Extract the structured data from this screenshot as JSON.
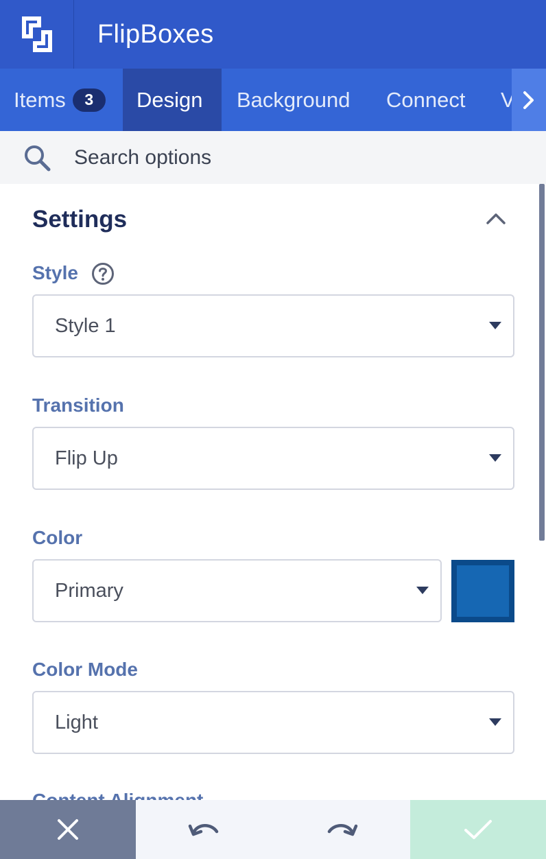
{
  "header": {
    "title": "FlipBoxes",
    "logo_icon": "flipboxes-logo-icon"
  },
  "tabs": [
    {
      "label": "Items",
      "badge": "3"
    },
    {
      "label": "Design",
      "active": true
    },
    {
      "label": "Background"
    },
    {
      "label": "Connect"
    },
    {
      "label": "V"
    }
  ],
  "search": {
    "placeholder": "Search options",
    "icon": "search-icon"
  },
  "settings": {
    "title": "Settings",
    "fields": [
      {
        "label": "Style",
        "value": "Style 1",
        "has_help": true
      },
      {
        "label": "Transition",
        "value": "Flip Up"
      },
      {
        "label": "Color",
        "value": "Primary",
        "swatch_color": "#1667b3"
      },
      {
        "label": "Color Mode",
        "value": "Light"
      },
      {
        "label": "Content Alignment"
      }
    ]
  },
  "bottom_bar": {
    "close_icon": "close-icon",
    "undo_icon": "undo-icon",
    "redo_icon": "redo-icon",
    "confirm_icon": "check-icon"
  },
  "colors": {
    "header_bg": "#3059c9",
    "tab_bar_bg": "#3465d6",
    "tab_active_bg": "#2a4aa6",
    "label_color": "#5572ad",
    "confirm_bg": "#c4ecdb",
    "close_bg": "#6f7b97"
  }
}
